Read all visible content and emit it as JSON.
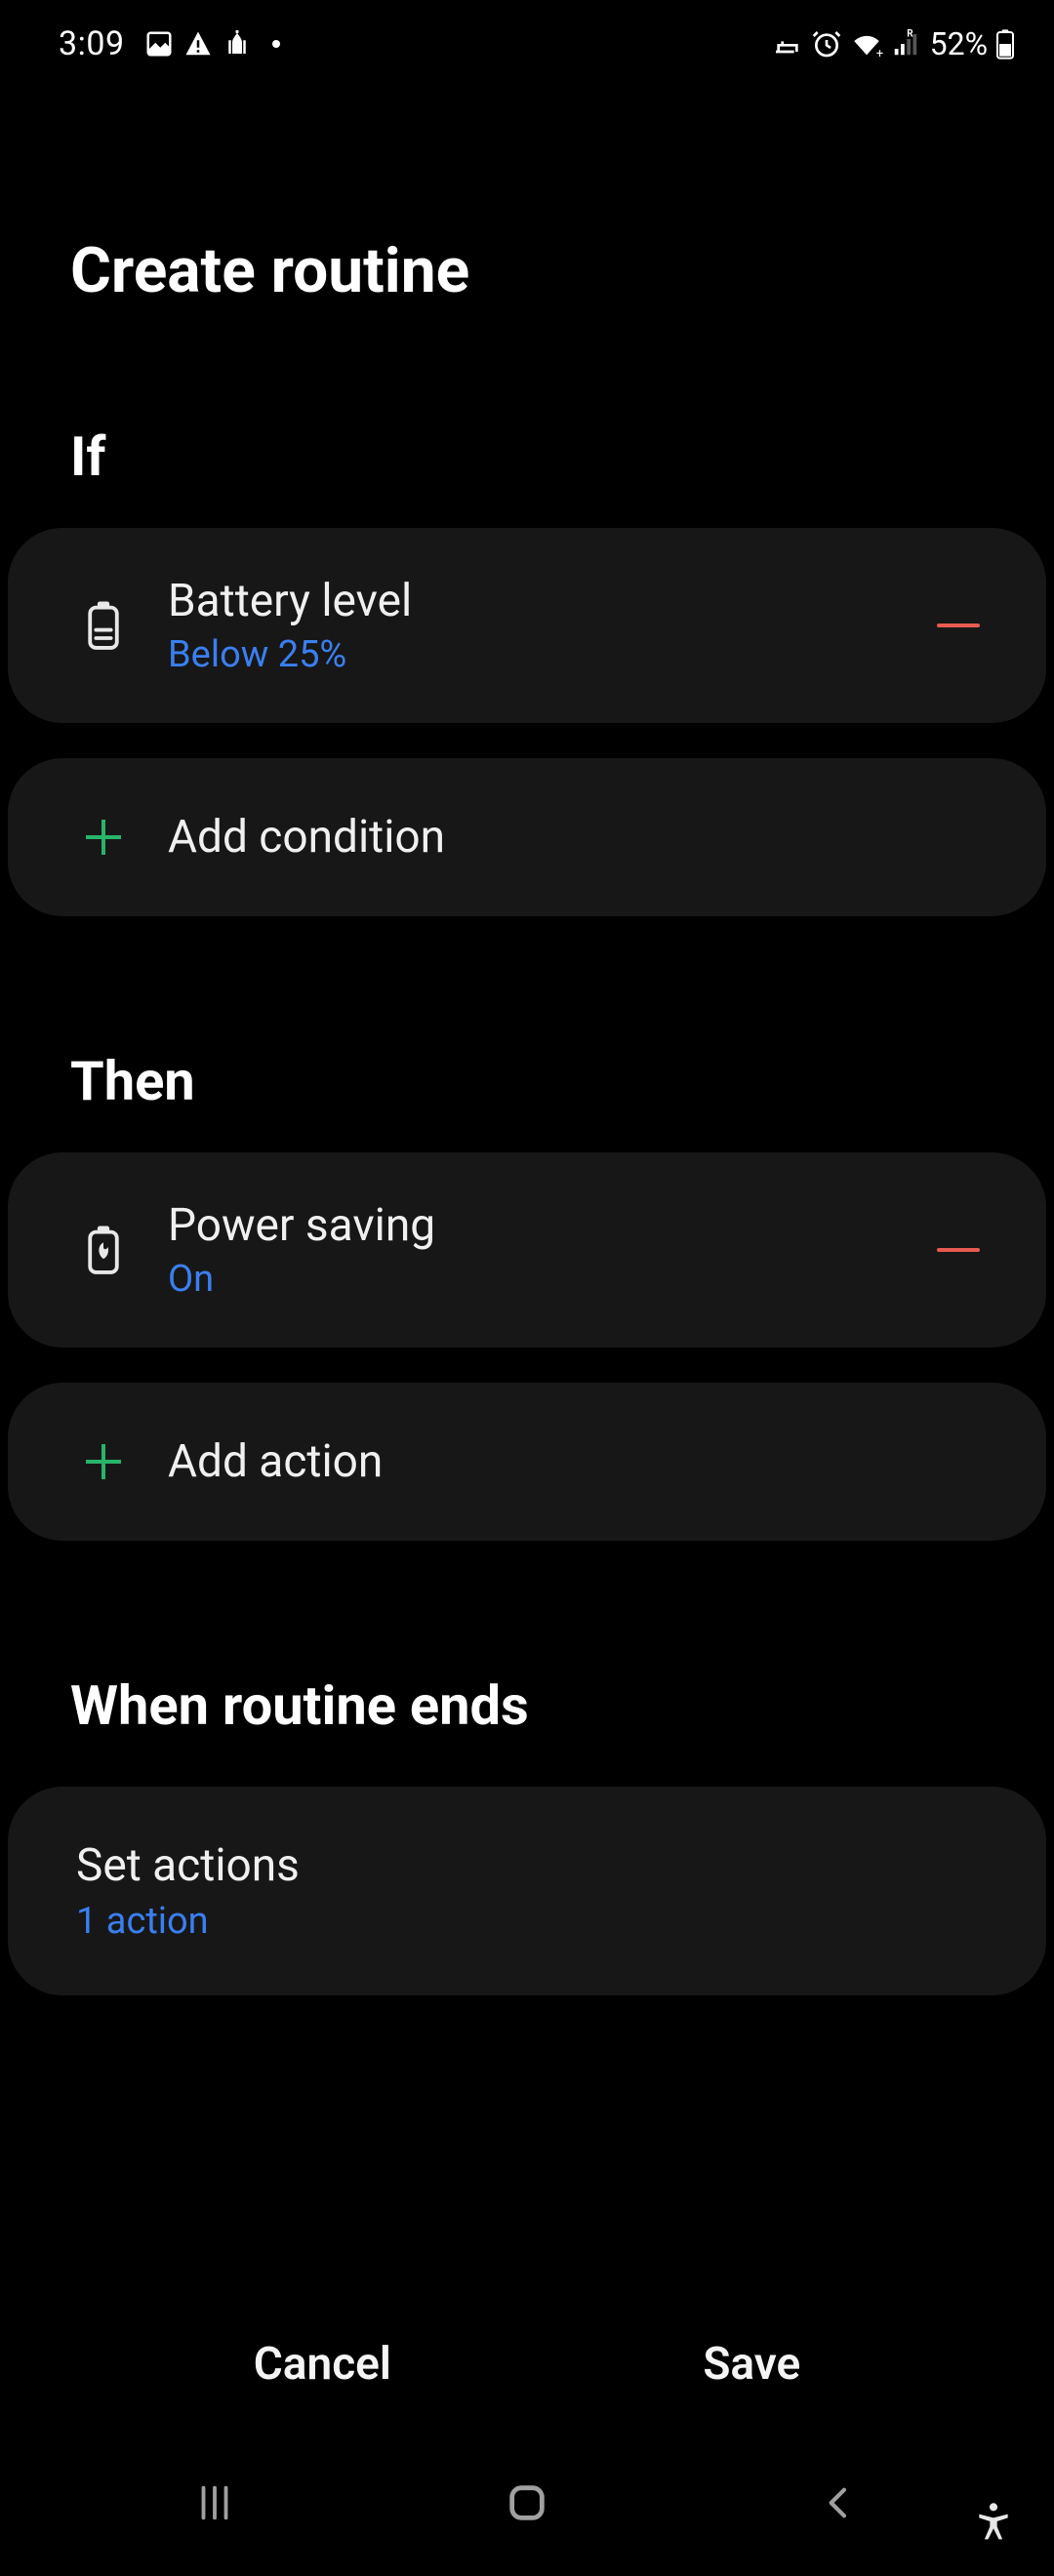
{
  "status": {
    "time": "3:09",
    "battery_pct": "52%"
  },
  "header": {
    "title": "Create routine"
  },
  "sections": {
    "if": {
      "label": "If",
      "condition": {
        "title": "Battery level",
        "sub": "Below 25%"
      },
      "add_label": "Add condition"
    },
    "then": {
      "label": "Then",
      "action": {
        "title": "Power saving",
        "sub": "On"
      },
      "add_label": "Add action"
    },
    "ends": {
      "label": "When routine ends",
      "set": {
        "title": "Set actions",
        "sub": "1 action"
      }
    }
  },
  "footer": {
    "cancel": "Cancel",
    "save": "Save"
  },
  "colors": {
    "accent_blue": "#3a7ff0",
    "remove_red": "#e85a4f",
    "add_green": "#28b46a"
  }
}
